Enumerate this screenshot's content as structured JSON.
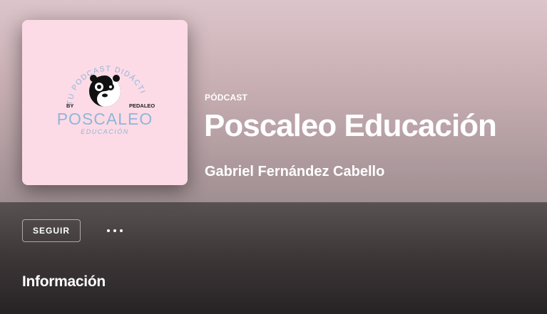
{
  "header": {
    "type_label": "PÓDCAST",
    "title": "Poscaleo Educación",
    "author": "Gabriel Fernández Cabello"
  },
  "cover": {
    "arc_text": "TU PODCAST DIDÁCTICO",
    "by_left": "BY",
    "by_right": "PEDALEO",
    "brand": "POSCALEO",
    "subbrand": "EDUCACIÓN"
  },
  "actions": {
    "follow_label": "SEGUIR",
    "more_icon": "ellipsis-icon"
  },
  "about": {
    "heading": "Información"
  },
  "colors": {
    "cover_bg": "#fcdbe6",
    "cover_text": "#8fb6da"
  }
}
